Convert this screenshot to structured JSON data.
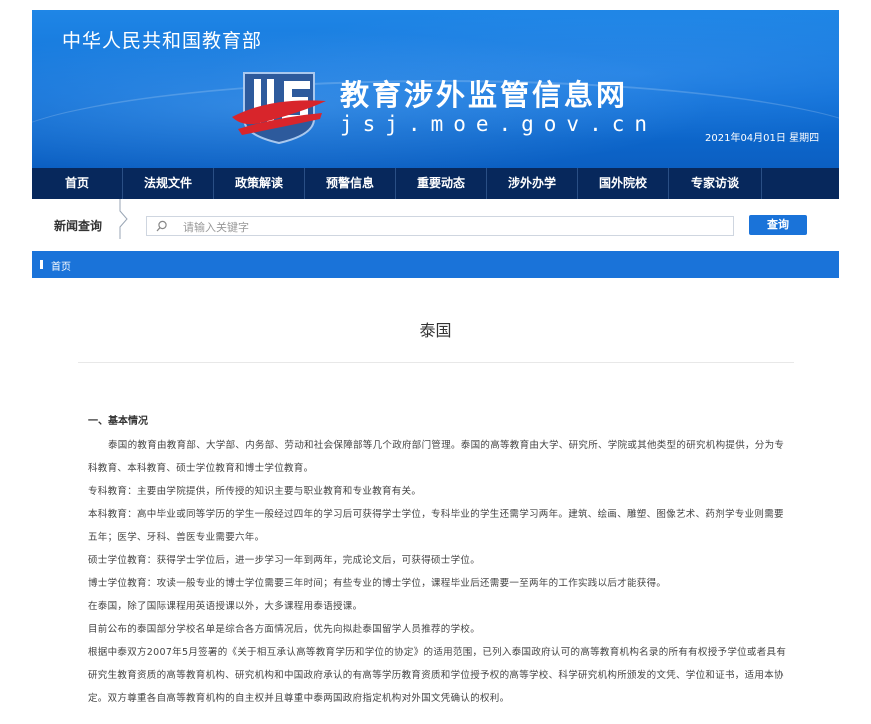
{
  "header": {
    "ministry": "中华人民共和国教育部",
    "site_name": "教育涉外监管信息网",
    "site_url": "jsj.moe.gov.cn",
    "date": "2021年04月01日 星期四",
    "logo_icon": "jsj-logo-icon",
    "colors": {
      "banner": "#1373dd",
      "nav": "#07285c",
      "accent": "#1a73d9"
    }
  },
  "nav": {
    "items": [
      {
        "label": "首页"
      },
      {
        "label": "法规文件"
      },
      {
        "label": "政策解读"
      },
      {
        "label": "预警信息"
      },
      {
        "label": "重要动态"
      },
      {
        "label": "涉外办学"
      },
      {
        "label": "国外院校"
      },
      {
        "label": "专家访谈"
      }
    ]
  },
  "search": {
    "label": "新闻查询",
    "placeholder": "请输入关键字",
    "button": "查询",
    "icon": "search-icon"
  },
  "breadcrumb": {
    "label": "首页"
  },
  "article": {
    "title": "泰国",
    "section_heading": "一、基本情况",
    "paragraphs": [
      "泰国的教育由教育部、大学部、内务部、劳动和社会保障部等几个政府部门管理。泰国的高等教育由大学、研究所、学院或其他类型的研究机构提供，分为专科教育、本科教育、硕士学位教育和博士学位教育。",
      "专科教育：主要由学院提供，所传授的知识主要与职业教育和专业教育有关。",
      "本科教育：高中毕业或同等学历的学生一般经过四年的学习后可获得学士学位，专科毕业的学生还需学习两年。建筑、绘画、雕塑、图像艺术、药剂学专业则需要五年；医学、牙科、兽医专业需要六年。",
      "硕士学位教育：获得学士学位后，进一步学习一年到两年，完成论文后，可获得硕士学位。",
      "博士学位教育：攻读一般专业的博士学位需要三年时间；有些专业的博士学位，课程毕业后还需要一至两年的工作实践以后才能获得。",
      "在泰国，除了国际课程用英语授课以外，大多课程用泰语授课。",
      "目前公布的泰国部分学校名单是综合各方面情况后，优先向拟赴泰国留学人员推荐的学校。",
      "根据中泰双方2007年5月签署的《关于相互承认高等教育学历和学位的协定》的适用范围，已列入泰国政府认可的高等教育机构名录的所有有权授予学位或者具有研究生教育资质的高等教育机构、研究机构和中国政府承认的有高等学历教育资质和学位授予权的高等学校、科学研究机构所颁发的文凭、学位和证书，适用本协定。双方尊重各自高等教育机构的自主权并且尊重中泰两国政府指定机构对外国文凭确认的权利。"
    ]
  }
}
